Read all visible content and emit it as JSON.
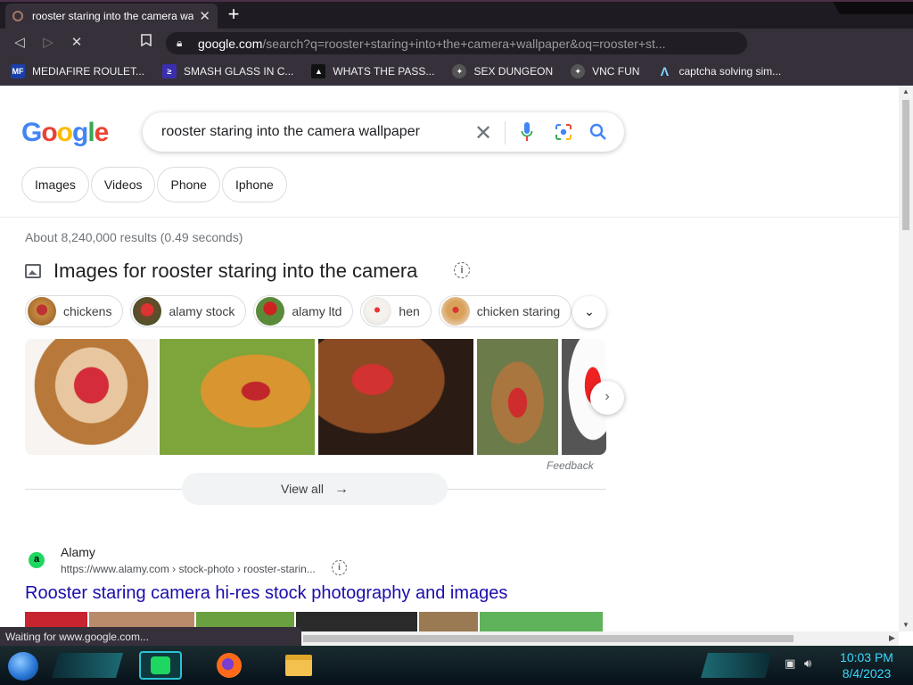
{
  "browser": {
    "tab_title": "rooster staring into the camera wa",
    "new_tab": "+",
    "url_domain": "google.com",
    "url_rest": "/search?q=rooster+staring+into+the+camera+wallpaper&oq=rooster+st...",
    "bookmarks": [
      {
        "label": "MEDIAFIRE ROULET...",
        "icon": "mediafire-icon"
      },
      {
        "label": "SMASH GLASS IN C...",
        "icon": "smash-icon"
      },
      {
        "label": "WHATS THE PASS...",
        "icon": "pass-icon"
      },
      {
        "label": "SEX DUNGEON",
        "icon": "dungeon-icon"
      },
      {
        "label": "VNC FUN",
        "icon": "vnc-icon"
      },
      {
        "label": "captcha solving sim...",
        "icon": "captcha-icon"
      }
    ],
    "status_text": "Waiting for www.google.com..."
  },
  "google": {
    "logo": "Google",
    "query": "rooster staring into the camera wallpaper",
    "filters": [
      "Images",
      "Videos",
      "Phone",
      "Iphone"
    ],
    "stats": "About 8,240,000 results (0.49 seconds)",
    "images_heading": "Images for rooster staring into the camera",
    "refine_chips": [
      "chickens",
      "alamy stock",
      "alamy ltd",
      "hen",
      "chicken staring"
    ],
    "feedback": "Feedback",
    "view_all": "View all",
    "result": {
      "site": "Alamy",
      "favicon_letter": "a",
      "url": "https://www.alamy.com › stock-photo › rooster-starin...",
      "title": "Rooster staring camera hi-res stock photography and images"
    }
  },
  "taskbar": {
    "time": "10:03 PM",
    "date": "8/4/2023"
  },
  "colors": {
    "chrome_dark": "#35303a",
    "link_blue": "#1a0dab",
    "clock_cyan": "#39d9ff"
  }
}
